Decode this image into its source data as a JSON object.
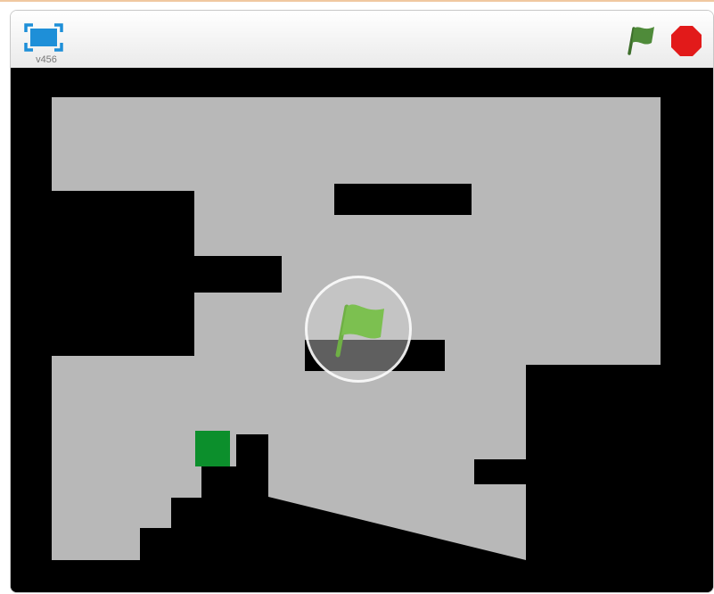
{
  "app": {
    "version_label": "v456",
    "icons": {
      "fullscreen": "fullscreen-icon",
      "green_flag": "green-flag-icon",
      "stop": "stop-sign-icon",
      "overlay_flag": "green-flag-icon"
    }
  },
  "colors": {
    "fullscreen_blue": "#1e8fd8",
    "flag_green": "#4f8b3a",
    "overlay_flag_green": "#7cc050",
    "stop_red": "#e21a1a",
    "stage_wall": "#000000",
    "stage_floor": "#b8b8b8",
    "player_square": "#0c8f2c"
  }
}
